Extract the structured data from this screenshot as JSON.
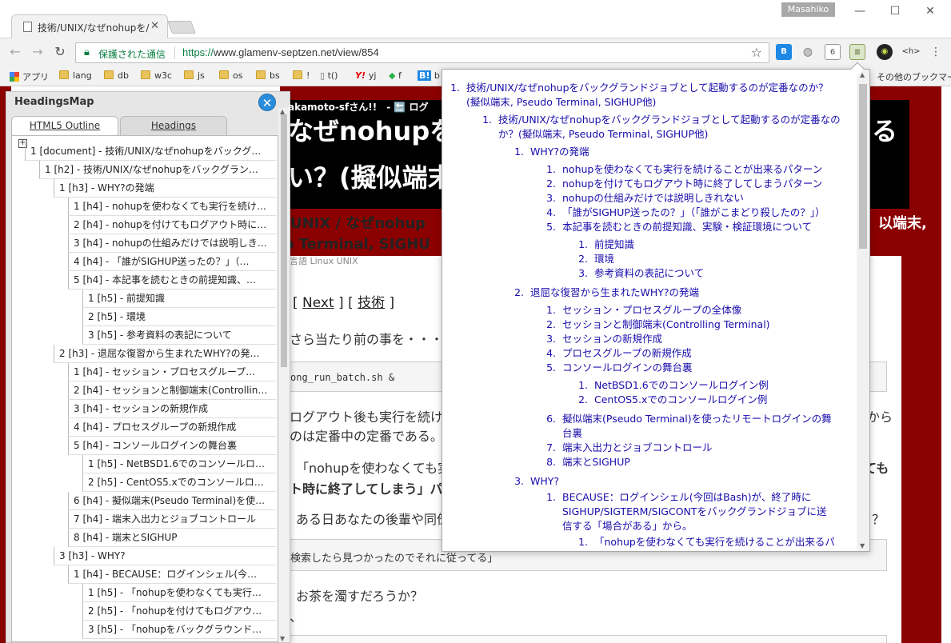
{
  "window": {
    "tab_title": "技術/UNIX/なぜnohupを/",
    "user": "Masahiko",
    "minimize": "—",
    "maximize": "☐",
    "close": "✕"
  },
  "toolbar": {
    "secure_label": "保護された通信",
    "url_scheme": "https://",
    "url_rest": "www.glamenv-septzen.net/view/854",
    "ext_6": "6",
    "ext_h": "<h>"
  },
  "bookmarks": {
    "apps": "アプリ",
    "items": [
      "lang",
      "db",
      "w3c",
      "js",
      "os",
      "bs",
      "!",
      "t()",
      "yj",
      "f",
      "b"
    ],
    "other": "その他のブックマーク"
  },
  "page": {
    "greeting": "akamoto-sfさん!!　- 🔚 ログ",
    "banner_l1": "なぜnohupを",
    "banner_l1_right": "る",
    "banner_l2": "い？(擬似端末,",
    "crumb": "UNIX / なぜnohup",
    "crumb2": "o Terminal, SIGHU",
    "crumb_right": "以端末,",
    "tags": "言語 Linux UNIX",
    "nav_next": "Next",
    "nav_tech": "技術",
    "p1": "さら当たり前の事を・・・",
    "code1": "ong_run_batch.sh &",
    "p2": "ログアウト後も実行を続け",
    "p2b": "のは定番中の定番である。",
    "p2r": "から",
    "p3": "「nohupを使わなくても実",
    "p3b": "ト時に終了してしまう」パ",
    "p3r": "ても",
    "p4": "ある日あなたの後輩や同僚",
    "p4r": "？",
    "quote": "検索したら見つかったのでそれに従ってる」",
    "p5": "お茶を濁すだろうか？",
    "p5b": "、"
  },
  "headingsmap": {
    "title": "HeadingsMap",
    "tab_outline": "HTML5 Outline",
    "tab_headings": "Headings",
    "items": [
      {
        "text": "1 [document] - 技術/UNIX/なぜnohupをバックグ…"
      },
      {
        "text": "1 [h2] - 技術/UNIX/なぜnohupをバックグラン…"
      },
      {
        "text": "1 [h3] - WHY?の発端"
      },
      {
        "text": "1 [h4] - nohupを使わなくても実行を続け…"
      },
      {
        "text": "2 [h4] - nohupを付けてもログアウト時に…"
      },
      {
        "text": "3 [h4] - nohupの仕組みだけでは説明しき…"
      },
      {
        "text": "4 [h4] - 「誰がSIGHUP送ったの？」（…"
      },
      {
        "text": "5 [h4] - 本記事を読むときの前提知識、…"
      },
      {
        "text": "1 [h5] - 前提知識"
      },
      {
        "text": "2 [h5] - 環境"
      },
      {
        "text": "3 [h5] - 参考資料の表記について"
      },
      {
        "text": "2 [h3] - 退屈な復習から生まれたWHY?の発…"
      },
      {
        "text": "1 [h4] - セッション・プロセスグループ…"
      },
      {
        "text": "2 [h4] - セッションと制御端末(Controllin…"
      },
      {
        "text": "3 [h4] - セッションの新規作成"
      },
      {
        "text": "4 [h4] - プロセスグループの新規作成"
      },
      {
        "text": "5 [h4] - コンソールログインの舞台裏"
      },
      {
        "text": "1 [h5] - NetBSD1.6でのコンソールロ…"
      },
      {
        "text": "2 [h5] - CentOS5.xでのコンソールロ…"
      },
      {
        "text": "6 [h4] - 擬似端末(Pseudo Terminal)を使…"
      },
      {
        "text": "7 [h4] - 端末入出力とジョブコントロール"
      },
      {
        "text": "8 [h4] - 端末とSIGHUP"
      },
      {
        "text": "3 [h3] - WHY?"
      },
      {
        "text": "1 [h4] - BECAUSE：ログインシェル(今…"
      },
      {
        "text": "1 [h5] - 「nohupを使わなくても実行…"
      },
      {
        "text": "2 [h5] - 「nohupを付けてもログアウ…"
      },
      {
        "text": "3 [h5] - 「nohupをバックグラウンド…"
      }
    ]
  },
  "toc": {
    "items": [
      {
        "num": "1.",
        "text": "技術/UNIX/なぜnohupをバックグランドジョブとして起動するのが定番なのか？(擬似端末, Pseudo Terminal, SIGHUP他)"
      },
      {
        "num": "1.",
        "text": "技術/UNIX/なぜnohupをバックグランドジョブとして起動するのが定番なのか？(擬似端末, Pseudo Terminal, SIGHUP他)"
      },
      {
        "num": "1.",
        "text": "WHY?の発端"
      },
      {
        "num": "1.",
        "text": "nohupを使わなくても実行を続けることが出来るパターン"
      },
      {
        "num": "2.",
        "text": "nohupを付けてもログアウト時に終了してしまうパターン"
      },
      {
        "num": "3.",
        "text": "nohupの仕組みだけでは説明しきれない"
      },
      {
        "num": "4.",
        "text": "「誰がSIGHUP送ったの？」（「誰がこまどり殺したの？」）"
      },
      {
        "num": "5.",
        "text": "本記事を読むときの前提知識、実験・検証環境について"
      },
      {
        "num": "1.",
        "text": "前提知識"
      },
      {
        "num": "2.",
        "text": "環境"
      },
      {
        "num": "3.",
        "text": "参考資料の表記について"
      },
      {
        "num": "2.",
        "text": "退屈な復習から生まれたWHY?の発端"
      },
      {
        "num": "1.",
        "text": "セッション・プロセスグループの全体像"
      },
      {
        "num": "2.",
        "text": "セッションと制御端末(Controlling Terminal)"
      },
      {
        "num": "3.",
        "text": "セッションの新規作成"
      },
      {
        "num": "4.",
        "text": "プロセスグループの新規作成"
      },
      {
        "num": "5.",
        "text": "コンソールログインの舞台裏"
      },
      {
        "num": "1.",
        "text": "NetBSD1.6でのコンソールログイン例"
      },
      {
        "num": "2.",
        "text": "CentOS5.xでのコンソールログイン例"
      },
      {
        "num": "6.",
        "text": "擬似端末(Pseudo Terminal)を使ったリモートログインの舞台裏"
      },
      {
        "num": "7.",
        "text": "端末入出力とジョブコントロール"
      },
      {
        "num": "8.",
        "text": "端末とSIGHUP"
      },
      {
        "num": "3.",
        "text": "WHY?"
      },
      {
        "num": "1.",
        "text": "BECAUSE：ログインシェル(今回はBash)が、終了時にSIGHUP/SIGTERM/SIGCONTをバックグランドジョブに送信する「場合がある」から。"
      },
      {
        "num": "1.",
        "text": "「nohupを使わなくても実行を続けることが出来るパ"
      }
    ]
  },
  "colors": {
    "site_red": "#8b0000",
    "link": "#1a0dab",
    "secure_green": "#0b8043",
    "close_blue": "#2a8ddb"
  }
}
